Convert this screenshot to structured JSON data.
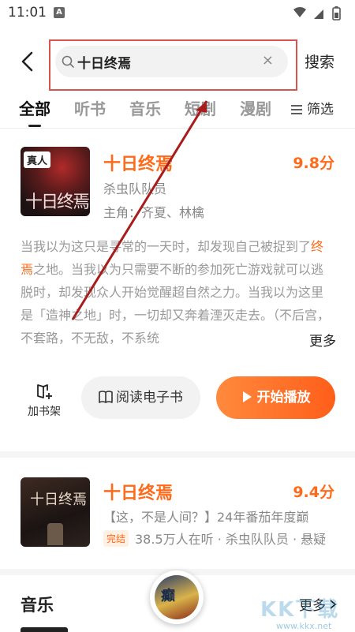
{
  "status_bar": {
    "time": "11:01",
    "indicator": "A"
  },
  "header": {
    "search_value": "十日终焉",
    "clear_symbol": "×",
    "search_button": "搜索"
  },
  "tabs": {
    "items": [
      "全部",
      "听书",
      "音乐",
      "短剧",
      "漫剧"
    ],
    "active": "全部",
    "filter_label": "筛选"
  },
  "result1": {
    "cover_tag": "真人",
    "cover_text": "十日终焉",
    "title": "十日终焉",
    "score": "9.8分",
    "author": "杀虫队队员",
    "cast": "主角：齐夏、林檎",
    "desc_before": "当我以为这只是寻常的一天时，却发现自己被捉到了",
    "desc_highlight": "终焉",
    "desc_after": "之地。当我以为只需要不断的参加死亡游戏就可以逃脱时，却发现众人开始觉醒超自然之力。当我以为这里是「造神之地」时，一切却又奔着湮灭走去。（不后宫，不套路，不无敌，不系统",
    "more_label": "更多",
    "shelf_label": "加书架",
    "read_label": "阅读电子书",
    "play_label": "开始播放"
  },
  "result2": {
    "cover_text": "十日终焉",
    "title": "十日终焉",
    "score": "9.4分",
    "desc": "【这，不是人间？】24年番茄年度巅",
    "badge": "完结",
    "meta": "38.5万人在听 · 杀虫队队员 · 悬疑"
  },
  "music": {
    "title": "音乐",
    "more_label": "更多",
    "mini_player_text": "癫"
  },
  "watermark": {
    "text": "KK下载",
    "url": "www.kkx.net"
  },
  "colors": {
    "accent": "#ff6a1a",
    "annotation": "#d9534f"
  }
}
